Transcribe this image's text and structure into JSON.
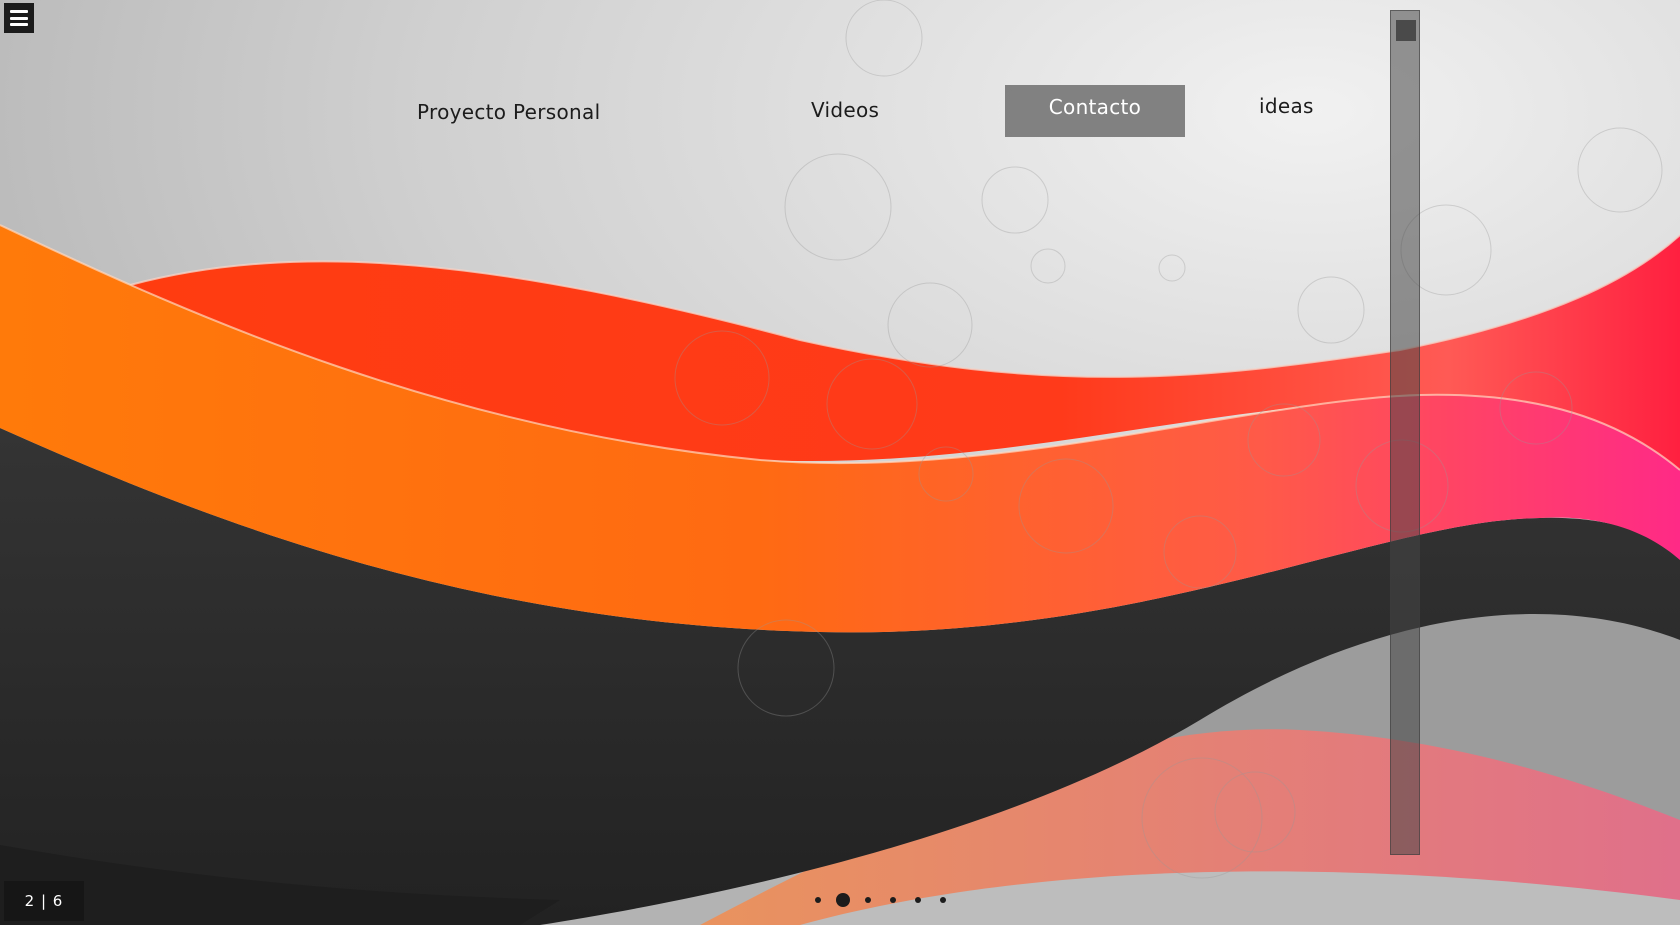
{
  "nav": {
    "items": [
      {
        "label": "Proyecto Personal"
      },
      {
        "label": "Videos"
      },
      {
        "label": "Contacto"
      },
      {
        "label": "ideas"
      }
    ]
  },
  "pager": {
    "counter": "2 | 6",
    "current": 2,
    "total": 6
  },
  "colors": {
    "accent_orange": "#ff6a10",
    "accent_red": "#ff3a12",
    "accent_pink": "#ff2f7a",
    "dark": "#2e2e2e",
    "active_nav_bg": "#6e6e6e"
  },
  "icons": {
    "menu": "hamburger-icon"
  }
}
